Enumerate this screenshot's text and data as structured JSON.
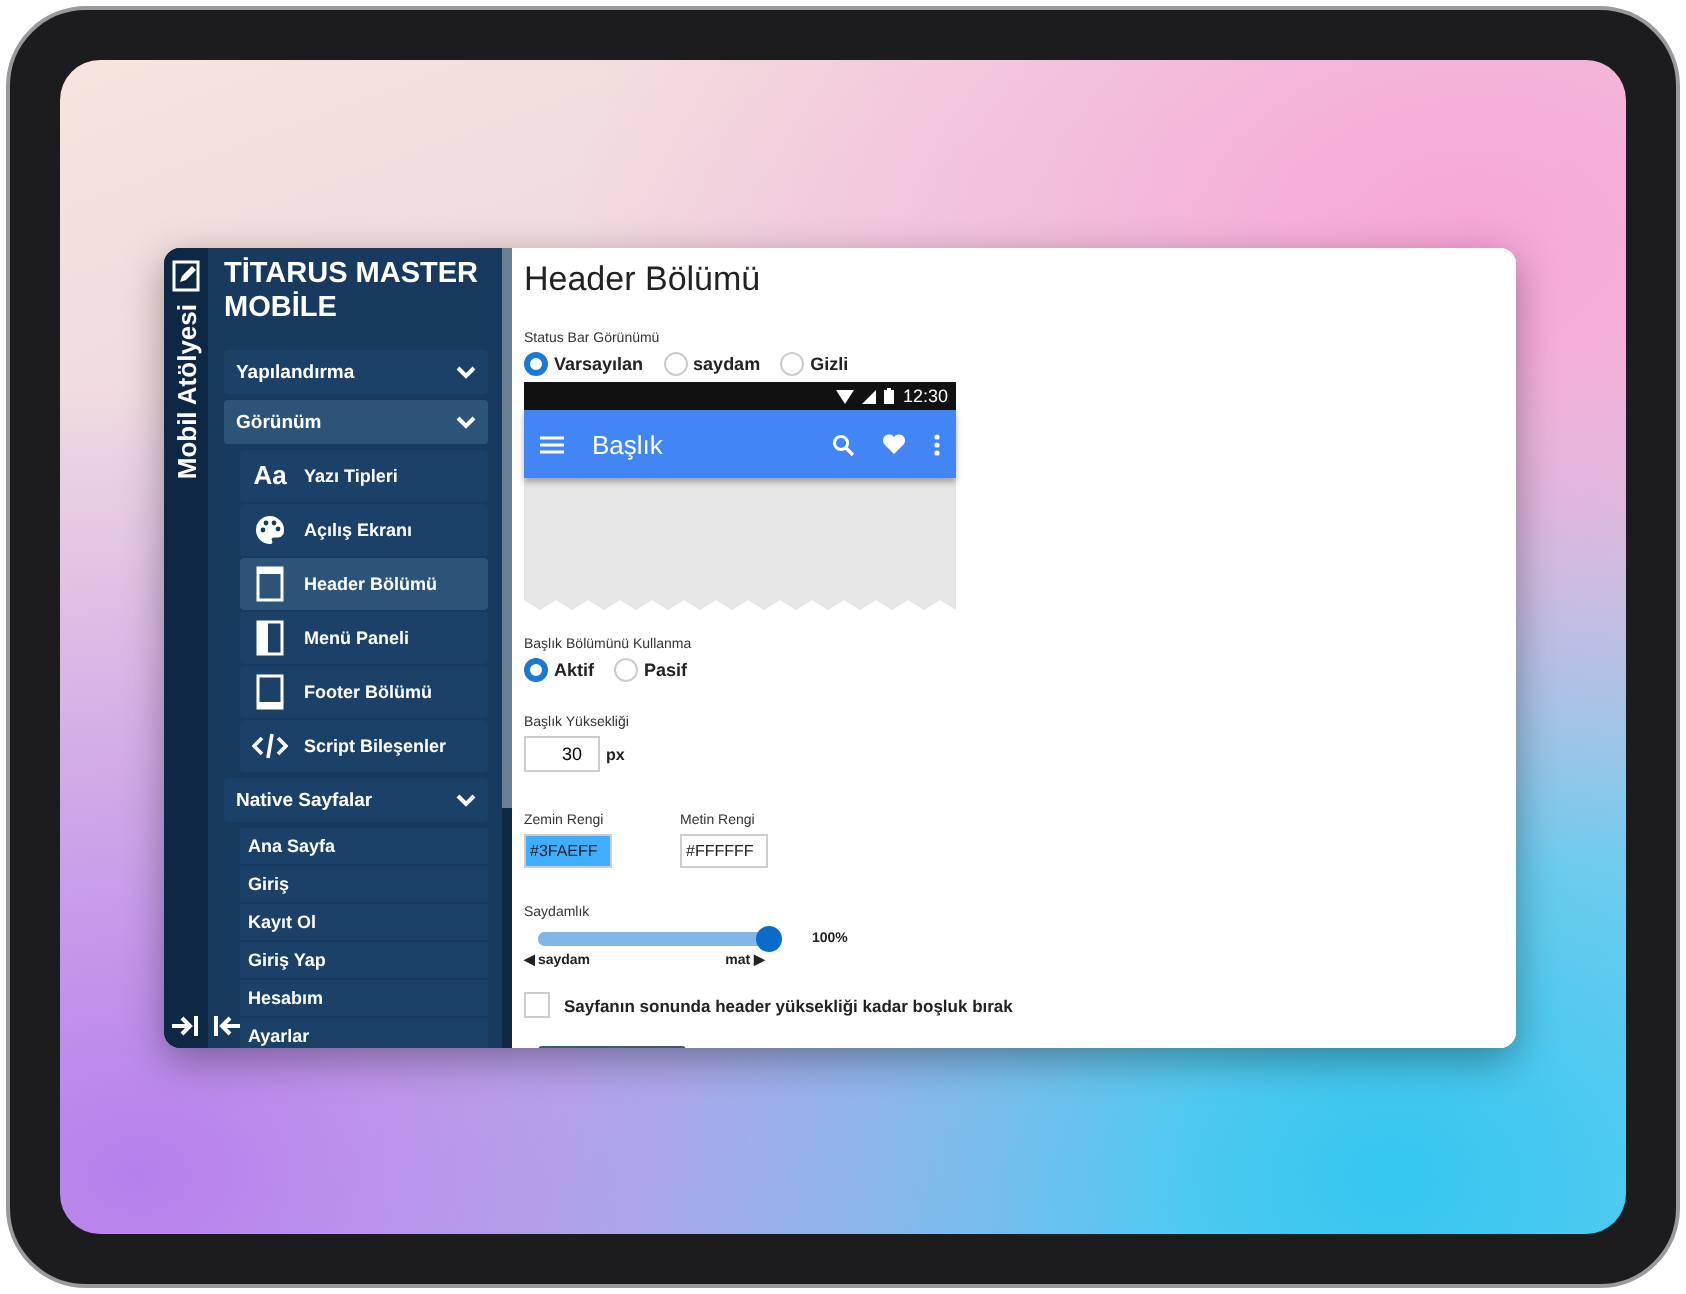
{
  "app": {
    "vertical_title": "Mobil Atölyesi",
    "title": "TİTARUS MASTER MOBİLE"
  },
  "sidebar": {
    "items": [
      {
        "label": "Yapılandırma",
        "selected": false
      },
      {
        "label": "Görünüm",
        "selected": true,
        "children": [
          {
            "label": "Yazı Tipleri",
            "selected": false,
            "icon_text": "Aa"
          },
          {
            "label": "Açılış Ekranı",
            "selected": false
          },
          {
            "label": "Header Bölümü",
            "selected": true
          },
          {
            "label": "Menü Paneli",
            "selected": false
          },
          {
            "label": "Footer Bölümü",
            "selected": false
          },
          {
            "label": "Script Bileşenler",
            "selected": false
          }
        ]
      },
      {
        "label": "Native Sayfalar",
        "selected": false,
        "children": [
          {
            "label": "Ana Sayfa",
            "selected": false
          },
          {
            "label": "Giriş",
            "selected": false
          },
          {
            "label": "Kayıt Ol",
            "selected": false
          },
          {
            "label": "Giriş Yap",
            "selected": false
          },
          {
            "label": "Hesabım",
            "selected": false
          },
          {
            "label": "Ayarlar",
            "selected": false
          }
        ]
      }
    ]
  },
  "content": {
    "title": "Header Bölümü",
    "status_bar": {
      "label": "Status Bar Görünümü",
      "options": [
        {
          "label": "Varsayılan",
          "selected": true
        },
        {
          "label": "saydam",
          "selected": false
        },
        {
          "label": "Gizli",
          "selected": false
        }
      ]
    },
    "preview": {
      "time": "12:30",
      "title": "Başlık"
    },
    "header_usage": {
      "label": "Başlık Bölümünü Kullanma",
      "options": [
        {
          "label": "Aktif",
          "selected": true
        },
        {
          "label": "Pasif",
          "selected": false
        }
      ]
    },
    "header_height": {
      "label": "Başlık Yüksekliği",
      "value": "30",
      "unit": "px"
    },
    "colors": [
      {
        "label": "Zemin Rengi",
        "value": "#3FAEFF",
        "color": "#3faeff"
      },
      {
        "label": "Metin Rengi",
        "value": "#FFFFFF",
        "color": "#ffffff"
      }
    ],
    "opacity": {
      "label": "Saydamlık",
      "level": 1,
      "reading": "100%",
      "min_label": "◀ saydam",
      "max_label": "mat ▶"
    },
    "spacer_option": {
      "label": "Sayfanın sonunda header yüksekliği kadar boşluk bırak",
      "checked": false
    }
  }
}
